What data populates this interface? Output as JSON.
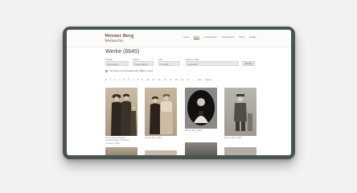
{
  "brand": {
    "title": "Werner Berg",
    "subtitle": "Werkarchiv"
  },
  "nav": [
    "Leben",
    "Werke",
    "Ausstellungen",
    "Literaturarchiv",
    "Briefe",
    "Kontakt"
  ],
  "nav_active_index": 1,
  "page_title": "Werke (6645)",
  "filters": [
    {
      "label": "Technik",
      "value": "Alle anzeigen"
    },
    {
      "label": "Thema",
      "value": "Thema wählen"
    },
    {
      "label": "Jahr",
      "value": "z.B. 1935"
    },
    {
      "label": "Suche im Titel",
      "value": "Suchbegriff"
    }
  ],
  "search_button": "Suchen",
  "checkbox_label": "Nur Werke mit hochauflösenden Bildern zeigen",
  "pagination": [
    "1",
    "2",
    "3",
    "4",
    "5",
    "6",
    "7",
    "8",
    "9",
    "10",
    "11",
    "12",
    "13",
    "14",
    "15",
    "16",
    "17",
    "…",
    "222",
    "weiter »"
  ],
  "pagination_current_index": 0,
  "cards": [
    {
      "caption": "Werner Berg, Mathilde Schellenberger und weitere Personen, 1921",
      "style": "photo-sepia"
    },
    {
      "caption": "Werner Berg, 1923",
      "style": "photo-sepia-2"
    },
    {
      "caption": "Werner Berg, 1924",
      "style": "photo-dark"
    },
    {
      "caption": "Werner Berg, 1925",
      "style": "photo-grey"
    }
  ],
  "colors": {
    "frame": "#4c5452",
    "brand": "#6a4a3c",
    "background": "#f2f2f0"
  }
}
